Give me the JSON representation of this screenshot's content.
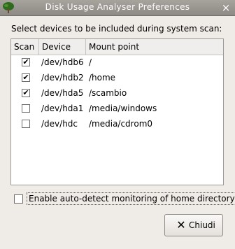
{
  "window": {
    "title": "Disk Usage Analyser Preferences",
    "icon": "tree-icon",
    "close_glyph": "×"
  },
  "prompt": "Select devices to be included during system scan:",
  "table": {
    "headers": {
      "scan": "Scan",
      "device": "Device",
      "mount": "Mount point"
    },
    "rows": [
      {
        "checked": true,
        "device": "/dev/hdb6",
        "mount": "/"
      },
      {
        "checked": true,
        "device": "/dev/hdb2",
        "mount": "/home"
      },
      {
        "checked": true,
        "device": "/dev/hda5",
        "mount": "/scambio"
      },
      {
        "checked": false,
        "device": "/dev/hda1",
        "mount": "/media/windows"
      },
      {
        "checked": false,
        "device": "/dev/hdc",
        "mount": "/media/cdrom0"
      }
    ]
  },
  "auto_detect": {
    "checked": false,
    "label": "Enable auto-detect monitoring of home directory"
  },
  "close_button": {
    "label": "Chiudi",
    "icon": "close-x-icon"
  },
  "colors": {
    "background": "#efebe7",
    "titlebar": "#8d8984"
  }
}
